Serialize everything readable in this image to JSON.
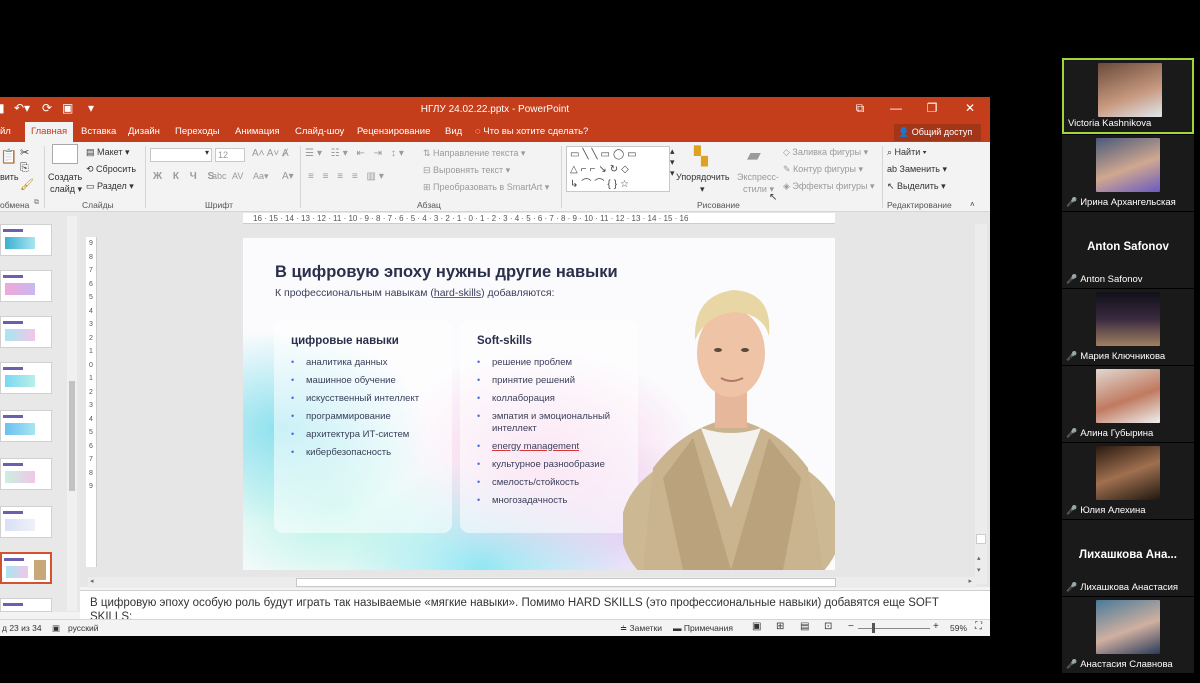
{
  "window": {
    "title": "НГЛУ 24.02.22.pptx - PowerPoint"
  },
  "tabs": [
    "Главная",
    "Вставка",
    "Дизайн",
    "Переходы",
    "Анимация",
    "Слайд-шоу",
    "Рецензирование",
    "Вид"
  ],
  "tab_partial": "йл",
  "tell_me": "Что вы хотите сделать?",
  "share_label": "Общий доступ",
  "ribbon": {
    "paste_partial": "вить",
    "create_slide": "Создать",
    "create_slide2": "слайд",
    "layout": "Макет",
    "reset": "Сбросить",
    "section": "Раздел",
    "font_size": "12",
    "text_direction": "Направление текста",
    "align_text": "Выровнять текст",
    "convert_smartart": "Преобразовать в SmartArt",
    "arrange": "Упорядочить",
    "quick_styles": "Экспресс-",
    "quick_styles2": "стили",
    "shape_fill": "Заливка фигуры",
    "shape_outline": "Контур фигуры",
    "shape_effects": "Эффекты фигуры",
    "find": "Найти",
    "replace": "Заменить",
    "select": "Выделить",
    "groups": {
      "clipboard": "обмена",
      "slides": "Слайды",
      "font": "Шрифт",
      "paragraph": "Абзац",
      "drawing": "Рисование",
      "editing": "Редактирование"
    }
  },
  "ruler_h": "16 · 15 · 14 · 13 · 12 · 11 · 10 · 9 · 8 · 7 · 6 · 5 · 4 · 3 · 2 · 1 · 0 · 1 · 2 · 3 · 4 · 5 · 6 · 7 · 8 · 9 · 10 · 11 · 12 · 13 · 14 · 15 · 16",
  "ruler_v": [
    "9",
    "8",
    "7",
    "6",
    "5",
    "4",
    "3",
    "2",
    "1",
    "0",
    "1",
    "2",
    "3",
    "4",
    "5",
    "6",
    "7",
    "8",
    "9"
  ],
  "slide": {
    "title": "В цифровую эпоху нужны другие навыки",
    "subtitle_pre": "К профессиональным навыкам (",
    "subtitle_hl": "hard-skills",
    "subtitle_post": ") добавляются:",
    "card1": {
      "title": "цифровые навыки",
      "items": [
        "аналитика данных",
        "машинное обучение",
        "искусственный интеллект",
        "программирование",
        "архитектура ИТ-систем",
        "кибербезопасность"
      ]
    },
    "card2": {
      "title": "Soft-skills",
      "items": [
        "решение проблем",
        "принятие решений",
        "коллаборация",
        "эмпатия и эмоциональный интеллект",
        "energy management",
        "культурное разнообразие",
        "смелость/стойкость",
        "многозадачность"
      ]
    }
  },
  "notes_lines": [
    "В цифровую эпоху особую роль будут играть так называемые «мягкие навыки». Помимо HARD SKILLS (это профессиональные навыки) добавятся еще SOFT SKILLS:"
  ],
  "status": {
    "slide_count": "д 23 из 34",
    "language": "русский",
    "notes_btn": "Заметки",
    "comments_btn": "Примечания",
    "zoom": "59%"
  },
  "participants": [
    {
      "name": "Victoria Kashnikova",
      "big": ""
    },
    {
      "name": "Ирина Архангельская",
      "big": ""
    },
    {
      "name": "Anton Safonov",
      "big": "Anton Safonov"
    },
    {
      "name": "Мария Ключникова",
      "big": ""
    },
    {
      "name": "Алина Губырина",
      "big": ""
    },
    {
      "name": "Юлия Алехина",
      "big": ""
    },
    {
      "name": "Лихашкова Анастасия",
      "big": "Лихашкова Ана..."
    },
    {
      "name": "Анастасия Славнова",
      "big": ""
    }
  ],
  "colors": {
    "ppt_red": "#c43e1c",
    "zoom_active": "#a0d63a",
    "bullet": "#4a6ad8"
  }
}
